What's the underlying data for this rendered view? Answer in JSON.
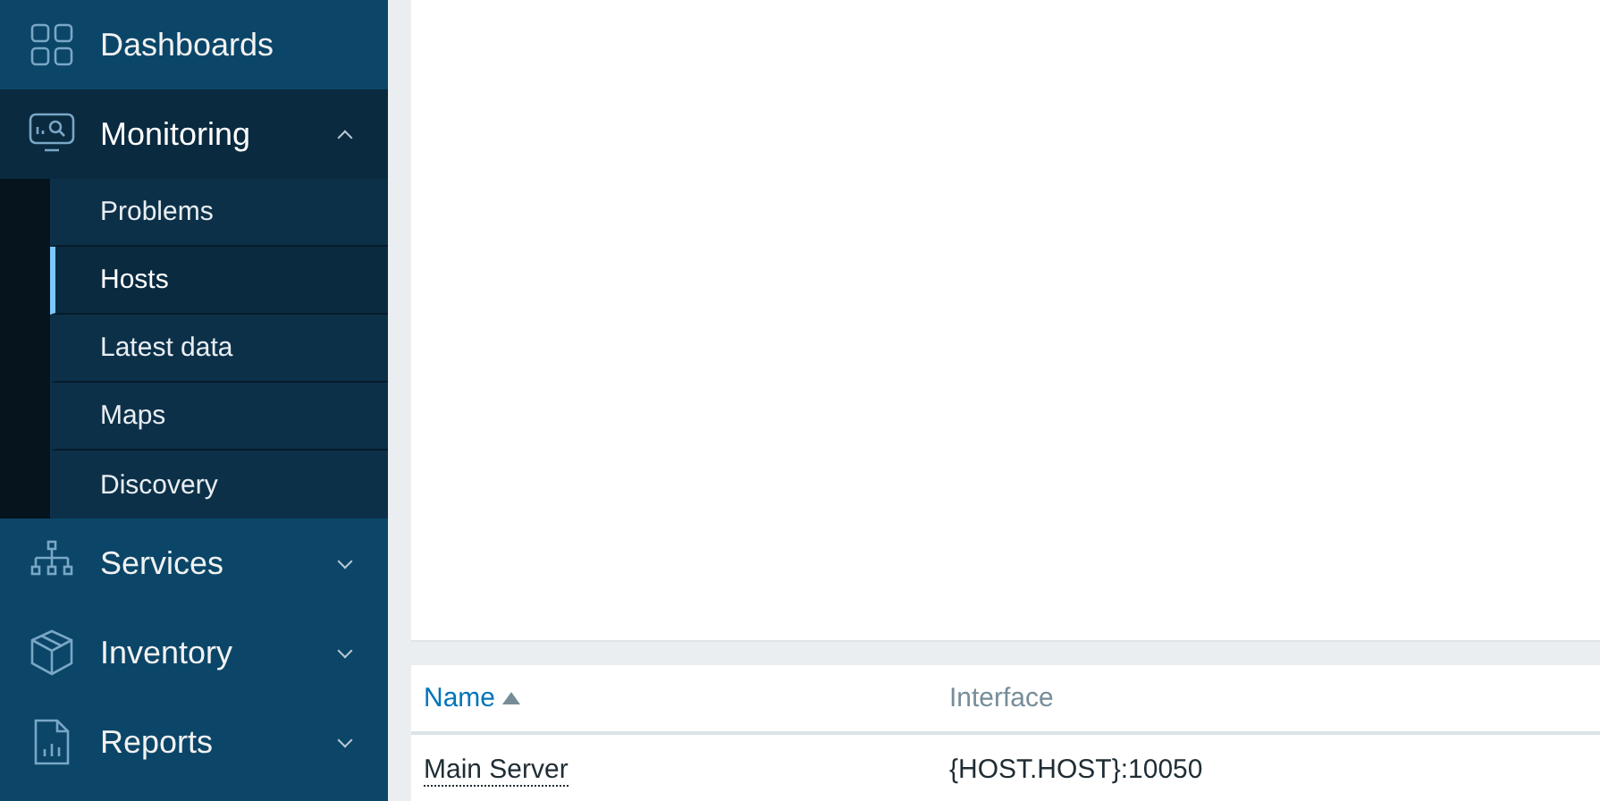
{
  "sidebar": {
    "items": [
      {
        "label": "Dashboards",
        "selected": false
      },
      {
        "label": "Monitoring",
        "selected": true,
        "expanded": true,
        "children": [
          {
            "label": "Problems",
            "selected": false
          },
          {
            "label": "Hosts",
            "selected": true
          },
          {
            "label": "Latest data",
            "selected": false
          },
          {
            "label": "Maps",
            "selected": false
          },
          {
            "label": "Discovery",
            "selected": false
          }
        ]
      },
      {
        "label": "Services",
        "selected": false,
        "expanded": false
      },
      {
        "label": "Inventory",
        "selected": false,
        "expanded": false
      },
      {
        "label": "Reports",
        "selected": false,
        "expanded": false
      }
    ]
  },
  "table": {
    "columns": [
      {
        "label": "Name",
        "sorted": true
      },
      {
        "label": "Interface",
        "sorted": false
      }
    ],
    "rows": [
      {
        "cells": [
          "Main Server",
          "{HOST.HOST}:10050"
        ]
      }
    ]
  }
}
